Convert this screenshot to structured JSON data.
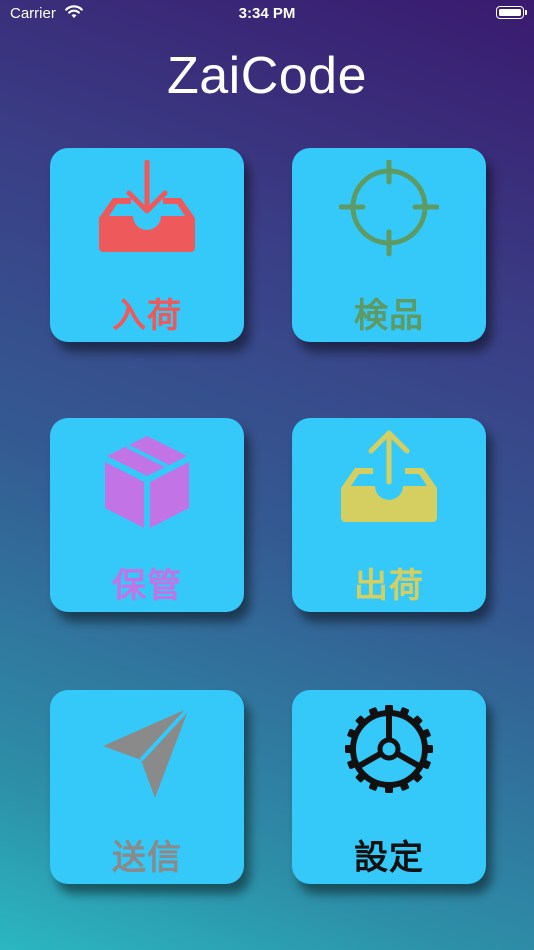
{
  "status_bar": {
    "carrier": "Carrier",
    "time": "3:34 PM"
  },
  "app": {
    "title": "ZaiCode"
  },
  "menu": [
    {
      "label": "入荷",
      "icon": "inbox-download-icon",
      "color": "#ee5a5c"
    },
    {
      "label": "検品",
      "icon": "crosshair-icon",
      "color": "#5e9a64"
    },
    {
      "label": "保管",
      "icon": "box-icon",
      "color": "#c274e6"
    },
    {
      "label": "出荷",
      "icon": "inbox-upload-icon",
      "color": "#d4cf60"
    },
    {
      "label": "送信",
      "icon": "paper-plane-icon",
      "color": "#8a8a8a"
    },
    {
      "label": "設定",
      "icon": "gear-icon",
      "color": "#111111"
    }
  ]
}
